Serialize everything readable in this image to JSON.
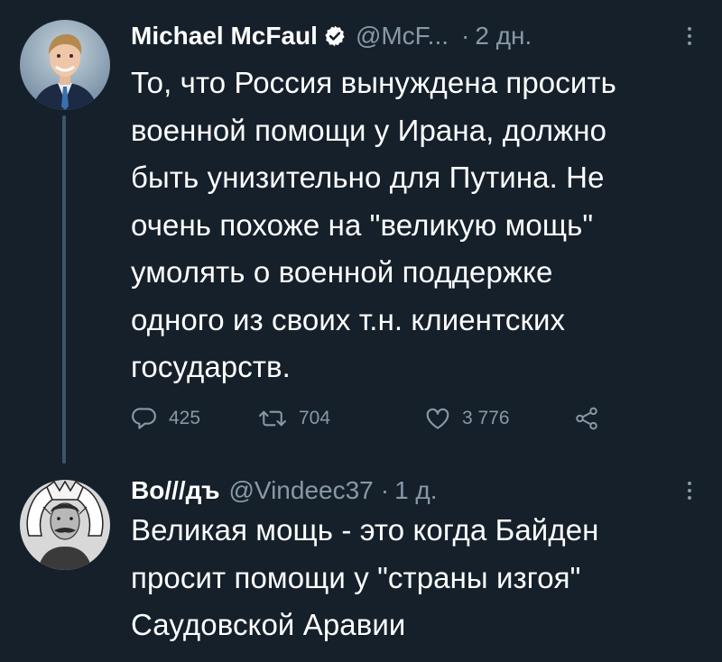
{
  "tweets": [
    {
      "author_name": "Michael McFaul",
      "handle": "@McF...",
      "separator": "·",
      "time": "2 дн.",
      "text": "То, что Россия вынуждена просить\nвоенной помощи у Ирана, должно\nбыть унизительно для Путина. Не\nочень похоже на \"великую мощь\"\nумолять о военной поддержке\nодного из своих т.н. клиентских\nгосударств.",
      "actions": {
        "replies": "425",
        "retweets": "704",
        "likes": "3 776"
      }
    },
    {
      "author_name": "Во///дъ",
      "handle": "@Vindeec37",
      "separator": "·",
      "time": "1 д.",
      "text": "Великая мощь - это когда Байден\nпросит помощи у \"страны изгоя\"\nСаудовской Аравии"
    }
  ],
  "icons": {
    "verified": "verified-badge-icon",
    "more": "more-options-icon",
    "reply": "reply-icon",
    "retweet": "retweet-icon",
    "like": "heart-icon",
    "share": "share-icon"
  },
  "colors": {
    "background": "#15202b",
    "primary_text": "#ffffff",
    "secondary_text": "#8899a6",
    "thread_line": "#3d5466"
  }
}
